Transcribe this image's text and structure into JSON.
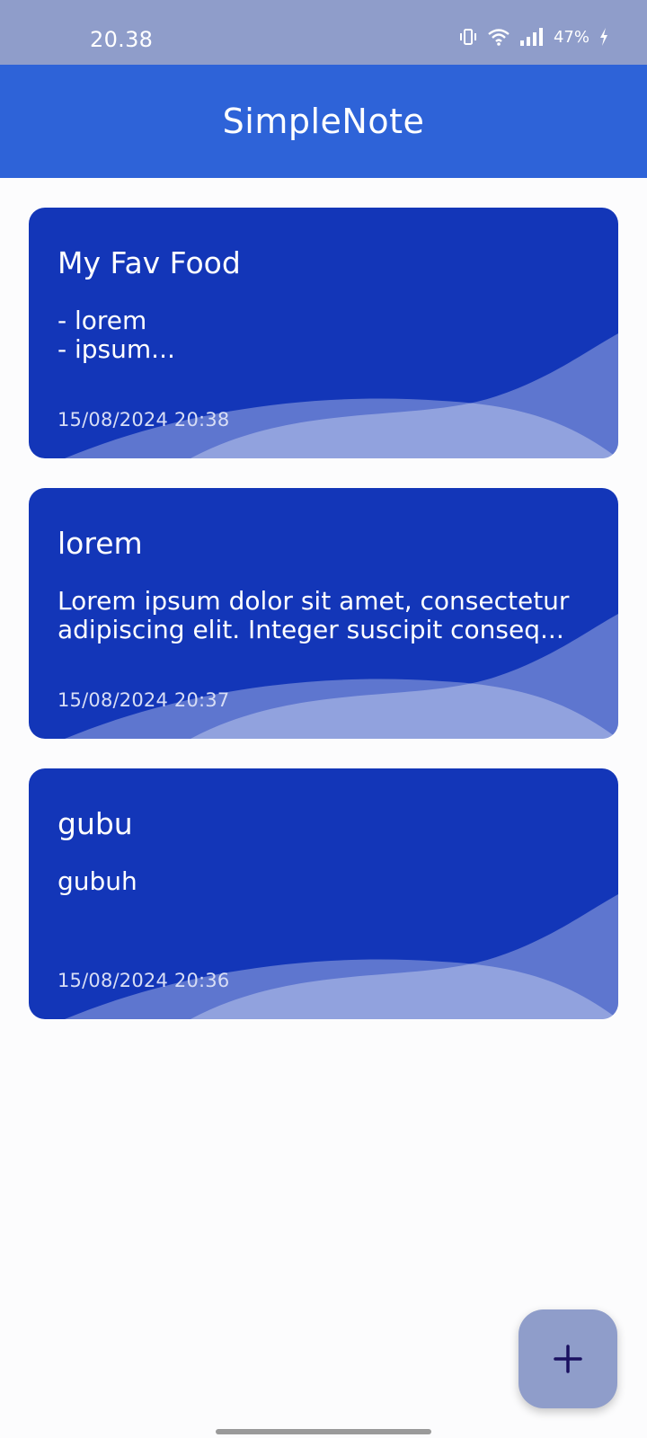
{
  "status_bar": {
    "time": "20.38",
    "battery": "47%",
    "icons": [
      "vibrate-icon",
      "wifi-icon",
      "signal-icon",
      "battery-charging-icon"
    ]
  },
  "app_bar": {
    "title": "SimpleNote"
  },
  "notes": [
    {
      "title": "My Fav Food",
      "body": "-  lorem\n- ipsum...",
      "date": "15/08/2024 20:38"
    },
    {
      "title": "lorem",
      "body": "Lorem ipsum dolor sit amet, consectetur adipiscing elit. Integer suscipit conseq...",
      "date": "15/08/2024 20:37"
    },
    {
      "title": "gubu",
      "body": "gubuh",
      "date": "15/08/2024 20:36"
    }
  ],
  "fab": {
    "icon": "plus-icon"
  },
  "colors": {
    "status_bar": "#8f9dca",
    "app_bar": "#2e63d8",
    "card": "#1336b8",
    "fab": "#8f9dca",
    "fab_icon": "#1a1060"
  }
}
